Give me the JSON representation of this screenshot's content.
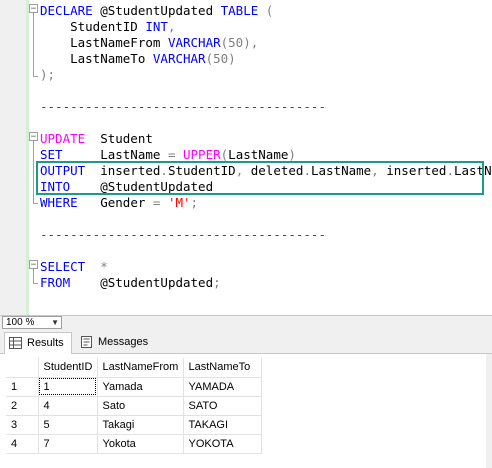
{
  "editor": {
    "lines": [
      [
        {
          "t": "DECLARE",
          "c": "kw"
        },
        {
          "t": " @StudentUpdated ",
          "c": ""
        },
        {
          "t": "TABLE",
          "c": "kw"
        },
        {
          "t": " (",
          "c": "gray"
        }
      ],
      [
        {
          "t": "    StudentID ",
          "c": ""
        },
        {
          "t": "INT",
          "c": "kw"
        },
        {
          "t": ",",
          "c": "gray"
        }
      ],
      [
        {
          "t": "    LastNameFrom ",
          "c": ""
        },
        {
          "t": "VARCHAR",
          "c": "kw"
        },
        {
          "t": "(50),",
          "c": "gray"
        }
      ],
      [
        {
          "t": "    LastNameTo ",
          "c": ""
        },
        {
          "t": "VARCHAR",
          "c": "kw"
        },
        {
          "t": "(50)",
          "c": "gray"
        }
      ],
      [
        {
          "t": ");",
          "c": "gray"
        }
      ],
      [],
      [
        {
          "t": "--------------------------------------",
          "c": "cm"
        }
      ],
      [],
      [
        {
          "t": "UPDATE",
          "c": "fn"
        },
        {
          "t": "  Student",
          "c": ""
        }
      ],
      [
        {
          "t": "SET",
          "c": "kw"
        },
        {
          "t": "     LastName ",
          "c": ""
        },
        {
          "t": "=",
          "c": "gray"
        },
        {
          "t": " ",
          "c": ""
        },
        {
          "t": "UPPER",
          "c": "fn"
        },
        {
          "t": "(",
          "c": "gray"
        },
        {
          "t": "LastName",
          "c": ""
        },
        {
          "t": ")",
          "c": "gray"
        }
      ],
      [
        {
          "t": "OUTPUT",
          "c": "kw"
        },
        {
          "t": "  inserted",
          "c": ""
        },
        {
          "t": ".",
          "c": "gray"
        },
        {
          "t": "StudentID",
          "c": ""
        },
        {
          "t": ",",
          "c": "gray"
        },
        {
          "t": " deleted",
          "c": ""
        },
        {
          "t": ".",
          "c": "gray"
        },
        {
          "t": "LastName",
          "c": ""
        },
        {
          "t": ",",
          "c": "gray"
        },
        {
          "t": " inserted",
          "c": ""
        },
        {
          "t": ".",
          "c": "gray"
        },
        {
          "t": "LastName",
          "c": ""
        }
      ],
      [
        {
          "t": "INTO",
          "c": "kw"
        },
        {
          "t": "    @StudentUpdated",
          "c": ""
        }
      ],
      [
        {
          "t": "WHERE",
          "c": "kw"
        },
        {
          "t": "   Gender ",
          "c": ""
        },
        {
          "t": "=",
          "c": "gray"
        },
        {
          "t": " ",
          "c": ""
        },
        {
          "t": "'M'",
          "c": "str"
        },
        {
          "t": ";",
          "c": "gray"
        }
      ],
      [],
      [
        {
          "t": "--------------------------------------",
          "c": "cm"
        }
      ],
      [],
      [
        {
          "t": "SELECT",
          "c": "kw"
        },
        {
          "t": "  ",
          "c": ""
        },
        {
          "t": "*",
          "c": "gray"
        }
      ],
      [
        {
          "t": "FROM",
          "c": "kw"
        },
        {
          "t": "    @StudentUpdated",
          "c": ""
        },
        {
          "t": ";",
          "c": "gray"
        }
      ]
    ]
  },
  "zoom": {
    "value": "100 %"
  },
  "tabs": {
    "results": "Results",
    "messages": "Messages"
  },
  "grid": {
    "columns": [
      "StudentID",
      "LastNameFrom",
      "LastNameTo"
    ],
    "rows": [
      {
        "n": "1",
        "id": "1",
        "from": "Yamada",
        "to": "YAMADA"
      },
      {
        "n": "2",
        "id": "4",
        "from": "Sato",
        "to": "SATO"
      },
      {
        "n": "3",
        "id": "5",
        "from": "Takagi",
        "to": "TAKAGI"
      },
      {
        "n": "4",
        "id": "7",
        "from": "Yokota",
        "to": "YOKOTA"
      }
    ]
  },
  "icons": {
    "results": "grid-icon",
    "messages": "messages-icon"
  },
  "colors": {
    "keyword": "#0000ff",
    "function": "#ff00ff",
    "string": "#ff0000",
    "comment": "#008000",
    "highlight": "#1a9c8c"
  }
}
